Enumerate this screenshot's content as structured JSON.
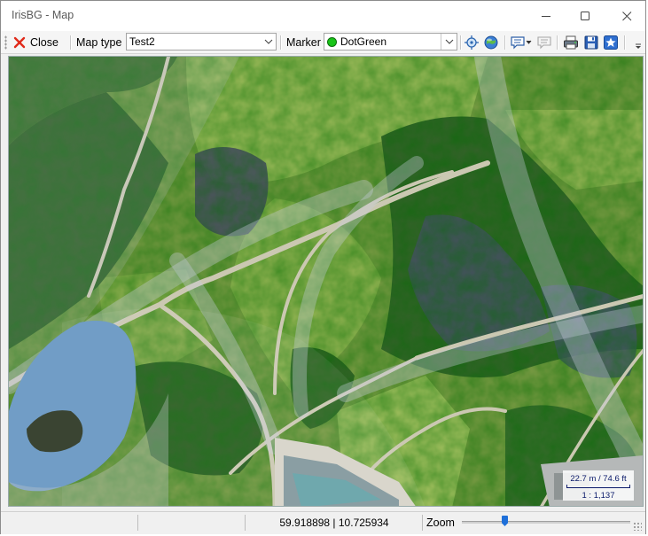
{
  "window": {
    "title": "IrisBG - Map"
  },
  "toolbar": {
    "close_label": "Close",
    "map_type_label": "Map type",
    "map_type_value": "Test2",
    "marker_label": "Marker",
    "marker_value": "DotGreen",
    "marker_color": "#18c418"
  },
  "map": {
    "scale_metric": "22.7 m / 74.6 ft",
    "scale_ratio": "1 : 1,137"
  },
  "status": {
    "coordinates": "59.918898 | 10.725934",
    "zoom_label": "Zoom"
  },
  "icons": [
    "close-x-icon",
    "crosshair-icon",
    "globe-icon",
    "comment-icon",
    "comment-gray-icon",
    "print-icon",
    "save-icon",
    "star-icon"
  ]
}
